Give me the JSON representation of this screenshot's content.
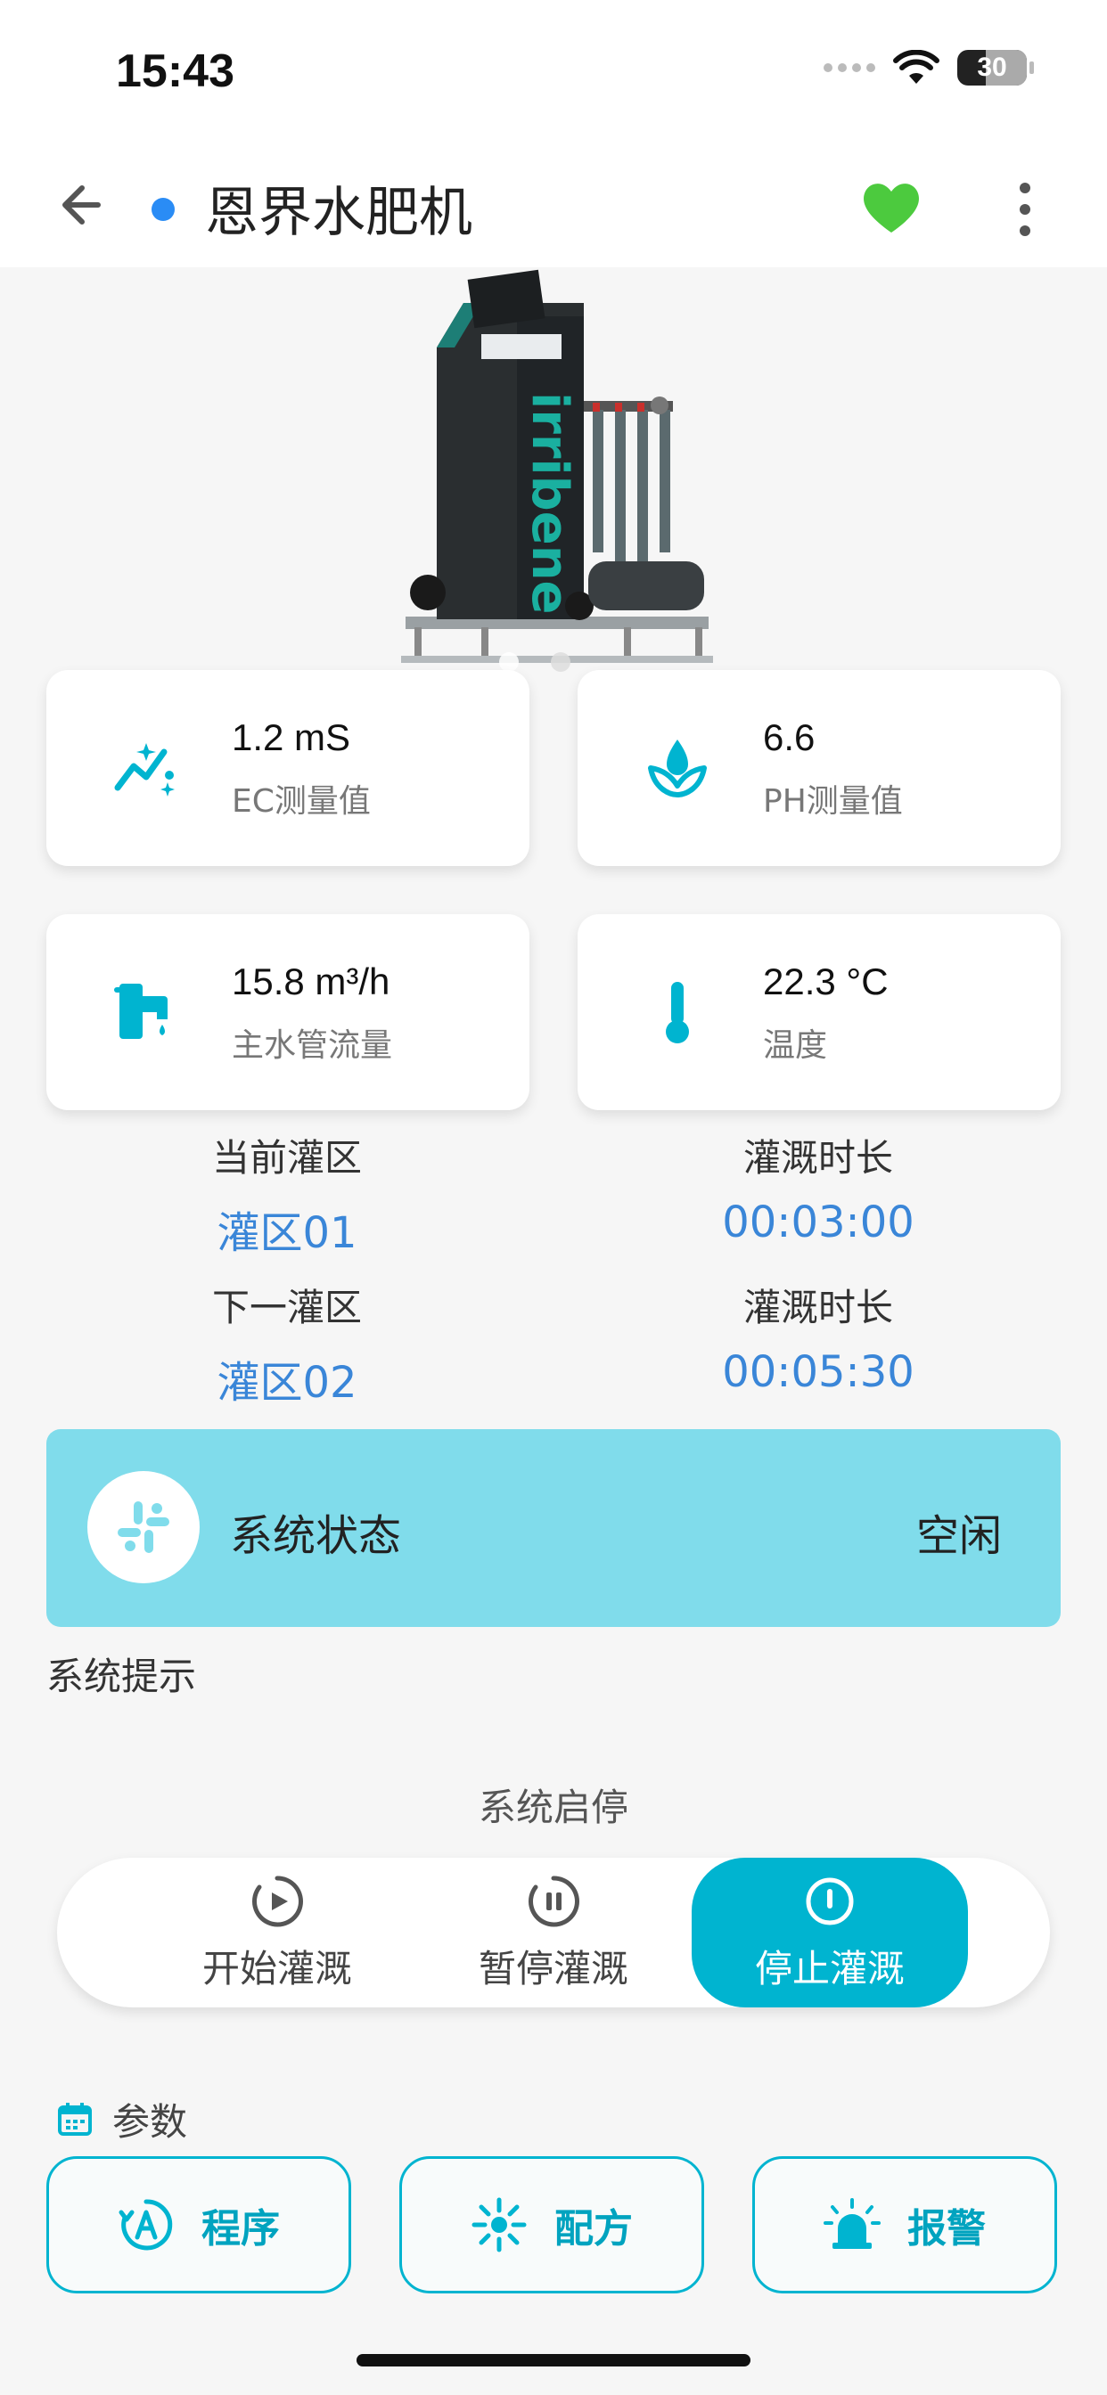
{
  "status_bar": {
    "time": "15:43",
    "battery": "30"
  },
  "nav": {
    "title": "恩界水肥机"
  },
  "accent_color": "#00b4d0",
  "metrics": [
    {
      "value": "1.2 mS",
      "label": "EC测量值",
      "icon": "trend-chart-icon"
    },
    {
      "value": "6.6",
      "label": "PH测量值",
      "icon": "water-drop-leaf-icon"
    },
    {
      "value": "15.8 m³/h",
      "label": "主水管流量",
      "icon": "faucet-icon"
    },
    {
      "value": "22.3 °C",
      "label": "温度",
      "icon": "thermometer-icon"
    }
  ],
  "zones": {
    "current_label": "当前灌区",
    "current_value": "灌区01",
    "current_duration_label": "灌溉时长",
    "current_duration": "00:03:00",
    "next_label": "下一灌区",
    "next_value": "灌区02",
    "next_duration_label": "灌溉时长",
    "next_duration": "00:05:30"
  },
  "system_status": {
    "label": "系统状态",
    "value": "空闲",
    "color": "#80dceb"
  },
  "system_hint_label": "系统提示",
  "start_stop": {
    "label": "系统启停",
    "buttons": [
      {
        "label": "开始灌溉",
        "icon": "play-circle-icon",
        "active": false
      },
      {
        "label": "暂停灌溉",
        "icon": "pause-circle-icon",
        "active": false
      },
      {
        "label": "停止灌溉",
        "icon": "stop-circle-icon",
        "active": true
      }
    ]
  },
  "params": {
    "title": "参数",
    "buttons": [
      {
        "label": "程序",
        "icon": "program-icon"
      },
      {
        "label": "配方",
        "icon": "formula-icon"
      },
      {
        "label": "报警",
        "icon": "alarm-icon"
      }
    ]
  }
}
